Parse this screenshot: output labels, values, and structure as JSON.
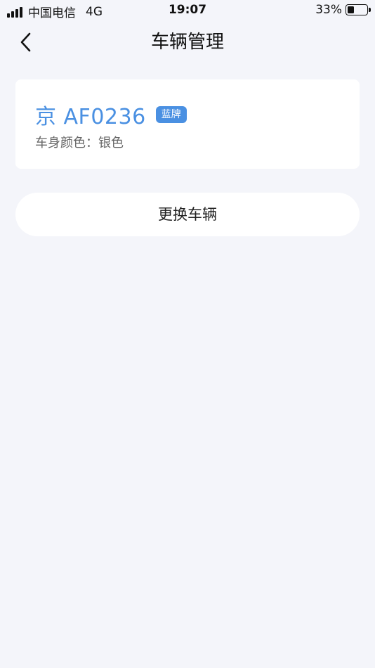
{
  "status_bar": {
    "carrier": "中国电信",
    "network": "4G",
    "time": "19:07",
    "battery_percent": "33%",
    "battery_level": 0.33
  },
  "header": {
    "title": "车辆管理",
    "back_icon": "chevron-left-icon"
  },
  "vehicle": {
    "plate": "京 AF0236",
    "plate_type": "蓝牌",
    "color_label": "车身颜色：银色"
  },
  "actions": {
    "change_vehicle": "更换车辆"
  },
  "colors": {
    "accent": "#4a90e2",
    "background": "#f4f5fa",
    "card": "#ffffff"
  }
}
